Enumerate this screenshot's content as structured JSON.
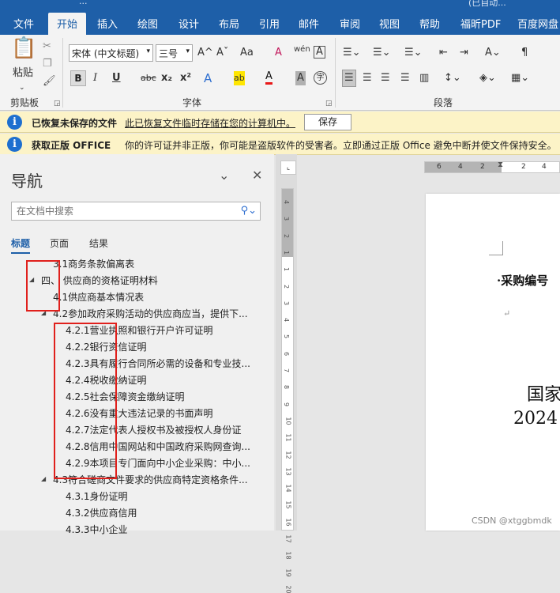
{
  "titlebar": {
    "left": "...",
    "right": "(已自动..."
  },
  "ribbon_tabs": [
    "文件",
    "开始",
    "插入",
    "绘图",
    "设计",
    "布局",
    "引用",
    "邮件",
    "审阅",
    "视图",
    "帮助",
    "福昕PDF",
    "百度网盘"
  ],
  "clipboard": {
    "paste": "粘贴",
    "label": "剪贴板"
  },
  "font": {
    "name": "宋体 (中文标题)",
    "size": "三号",
    "label": "字体",
    "bold": "B",
    "italic": "I",
    "underline": "U",
    "strike": "abc",
    "sub": "x₂",
    "sup": "x²",
    "grow": "A^",
    "shrink": "Aˇ",
    "case": "Aa",
    "clear": "A",
    "phonetic": "wén",
    "border": "A",
    "effect": "A",
    "highlight": "ab",
    "color": "A",
    "shade": "A",
    "enclose": "字"
  },
  "paragraph": {
    "label": "段落"
  },
  "bar1": {
    "title": "已恢复未保存的文件",
    "link": "此已恢复文件临时存储在您的计算机中。",
    "button": "保存"
  },
  "bar2": {
    "title": "获取正版 OFFICE",
    "text": "你的许可证并非正版，你可能是盗版软件的受害者。立即通过正版 Office 避免中断并使文件保持安全。"
  },
  "nav": {
    "title": "导航",
    "search_placeholder": "在文档中搜索",
    "tabs": [
      "标题",
      "页面",
      "结果"
    ],
    "items": [
      "3.1商务条款偏离表",
      "四、  供应商的资格证明材料",
      "4.1供应商基本情况表",
      "4.2参加政府采购活动的供应商应当，提供下...",
      "4.2.1营业执照和银行开户许可证明",
      "4.2.2银行资信证明",
      "4.2.3具有履行合同所必需的设备和专业技...",
      "4.2.4税收缴纳证明",
      "4.2.5社会保障资金缴纳证明",
      "4.2.6没有重大违法记录的书面声明",
      "4.2.7法定代表人授权书及被授权人身份证",
      "4.2.8信用中国网站和中国政府采购网查询...",
      "4.2.9本项目专门面向中小企业采购：中小...",
      "4.3符合磋商文件要求的供应商特定资格条件...",
      "4.3.1身份证明",
      "4.3.2供应商信用",
      "4.3.3中小企业"
    ]
  },
  "ruler": {
    "h": [
      "6",
      "4",
      "2",
      "2",
      "4"
    ],
    "v": [
      "4",
      "3",
      "2",
      "1",
      "1",
      "2",
      "3",
      "4",
      "5",
      "6",
      "7",
      "8",
      "9",
      "10",
      "11",
      "12",
      "13",
      "14",
      "15",
      "16",
      "17",
      "18",
      "19",
      "20"
    ]
  },
  "document": {
    "line1": "·采购编号",
    "line2": "国家",
    "line3": "2024",
    "mark": "↵"
  },
  "watermark": "CSDN @xtggbmdk"
}
